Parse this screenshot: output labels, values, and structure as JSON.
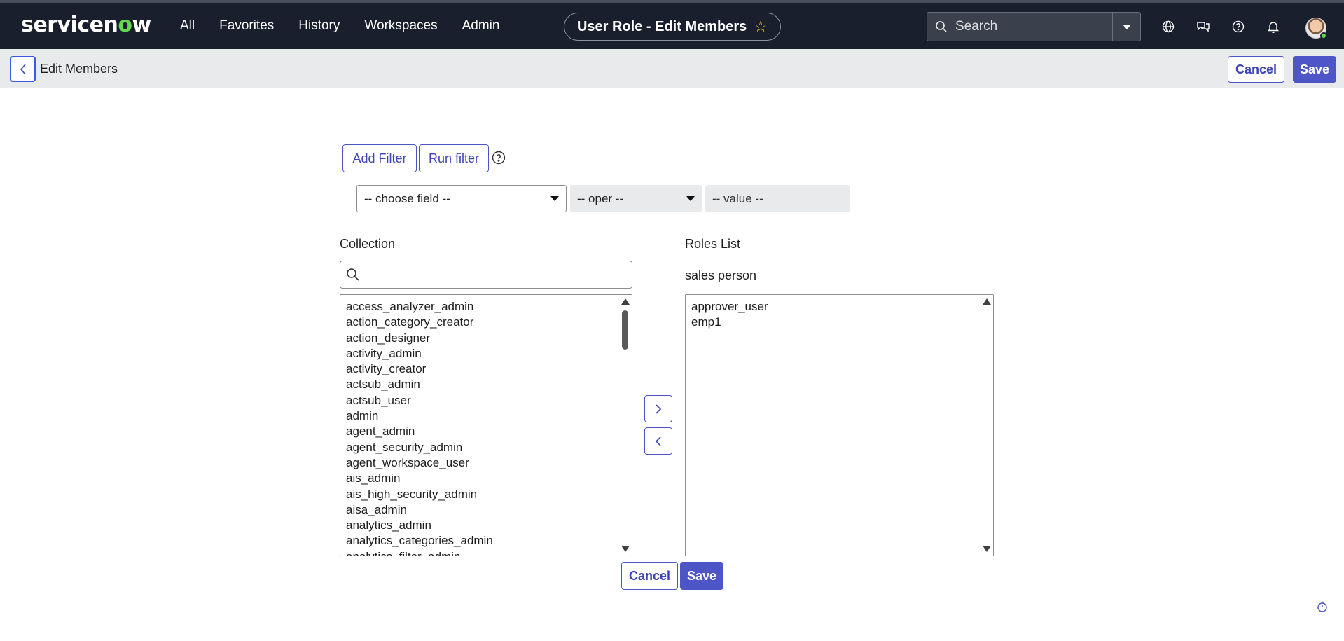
{
  "brand": {
    "logo_text_before": "servicen",
    "logo_text_o": "o",
    "logo_text_after": "w",
    "logo_accent": "#62d84e"
  },
  "nav": {
    "items": [
      "All",
      "Favorites",
      "History",
      "Workspaces",
      "Admin"
    ]
  },
  "context": {
    "title": "User Role - Edit Members",
    "favorite_icon": "star-icon"
  },
  "search": {
    "placeholder": "Search"
  },
  "header_icons": [
    "globe-icon",
    "chat-icon",
    "help-icon",
    "bell-icon",
    "avatar"
  ],
  "subheader": {
    "title": "Edit Members",
    "cancel_label": "Cancel",
    "save_label": "Save"
  },
  "filter": {
    "add_label": "Add Filter",
    "run_label": "Run filter",
    "field_placeholder": "-- choose field --",
    "oper_placeholder": "-- oper --",
    "value_placeholder": "-- value --"
  },
  "collection": {
    "label": "Collection",
    "search_value": "",
    "items": [
      "access_analyzer_admin",
      "action_category_creator",
      "action_designer",
      "activity_admin",
      "activity_creator",
      "actsub_admin",
      "actsub_user",
      "admin",
      "agent_admin",
      "agent_security_admin",
      "agent_workspace_user",
      "ais_admin",
      "ais_high_security_admin",
      "aisa_admin",
      "analytics_admin",
      "analytics_categories_admin",
      "analytics_filter_admin"
    ]
  },
  "roles_list": {
    "label": "Roles List",
    "group_name": "sales person",
    "items": [
      "approver_user",
      "emp1"
    ]
  },
  "footer": {
    "cancel_label": "Cancel",
    "save_label": "Save"
  },
  "colors": {
    "primary": "#4e56c7",
    "nav_bg": "#1a1f2e",
    "subheader_bg": "#e9eaec"
  }
}
